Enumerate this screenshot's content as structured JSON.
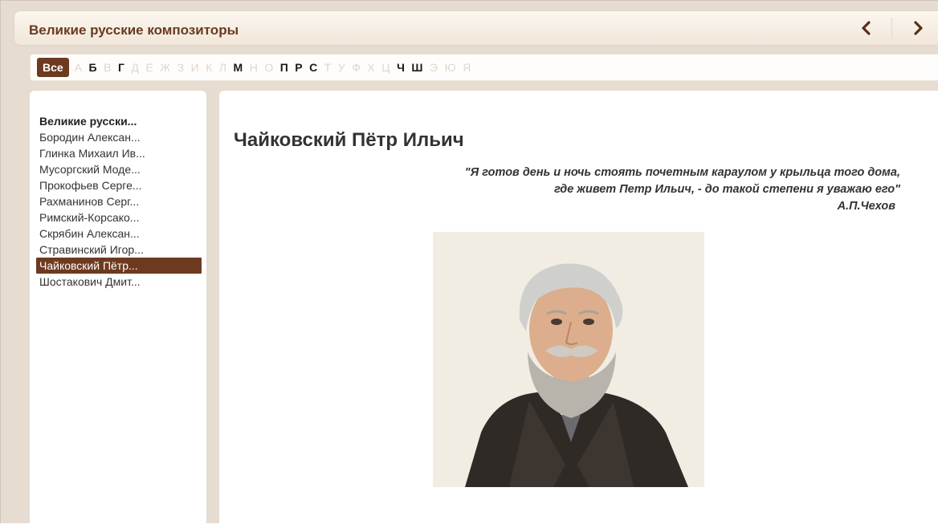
{
  "header": {
    "title": "Великие русские композиторы",
    "prev_icon": "chevron-left-icon",
    "next_icon": "chevron-right-icon"
  },
  "alphabet": {
    "all_label": "Все",
    "letters": [
      {
        "char": "А",
        "active": false
      },
      {
        "char": "Б",
        "active": true
      },
      {
        "char": "В",
        "active": false
      },
      {
        "char": "Г",
        "active": true
      },
      {
        "char": "Д",
        "active": false
      },
      {
        "char": "Е",
        "active": false
      },
      {
        "char": "Ж",
        "active": false
      },
      {
        "char": "З",
        "active": false
      },
      {
        "char": "И",
        "active": false
      },
      {
        "char": "К",
        "active": false
      },
      {
        "char": "Л",
        "active": false
      },
      {
        "char": "М",
        "active": true
      },
      {
        "char": "Н",
        "active": false
      },
      {
        "char": "О",
        "active": false
      },
      {
        "char": "П",
        "active": true
      },
      {
        "char": "Р",
        "active": true
      },
      {
        "char": "С",
        "active": true
      },
      {
        "char": "Т",
        "active": false
      },
      {
        "char": "У",
        "active": false
      },
      {
        "char": "Ф",
        "active": false
      },
      {
        "char": "Х",
        "active": false
      },
      {
        "char": "Ц",
        "active": false
      },
      {
        "char": "Ч",
        "active": true
      },
      {
        "char": "Ш",
        "active": true
      },
      {
        "char": "Э",
        "active": false
      },
      {
        "char": "Ю",
        "active": false
      },
      {
        "char": "Я",
        "active": false
      }
    ]
  },
  "sidebar": {
    "items": [
      {
        "label": "Великие русски...",
        "type": "heading"
      },
      {
        "label": "Бородин Алексан...",
        "type": "item"
      },
      {
        "label": "Глинка Михаил Ив...",
        "type": "item"
      },
      {
        "label": "Мусоргский Моде...",
        "type": "item"
      },
      {
        "label": "Прокофьев Серге...",
        "type": "item"
      },
      {
        "label": "Рахманинов Серг...",
        "type": "item"
      },
      {
        "label": "Римский-Корсако...",
        "type": "item"
      },
      {
        "label": "Скрябин Алексан...",
        "type": "item"
      },
      {
        "label": "Стравинский Игор...",
        "type": "item"
      },
      {
        "label": "Чайковский Пётр...",
        "type": "selected"
      },
      {
        "label": "Шостакович Дмит...",
        "type": "item"
      }
    ]
  },
  "main": {
    "composer_name": "Чайковский Пётр Ильич",
    "quote_line1": "\"Я готов день и ночь стоять почетным караулом у крыльца того дома,",
    "quote_line2": "где живет Петр Ильич, - до такой степени я уважаю его\"",
    "quote_author": "А.П.Чехов"
  },
  "colors": {
    "accent": "#6e3a1f",
    "title_text": "#6b3a20",
    "frame_bg": "#e6dcd1",
    "inactive_letter": "#e2d5cb"
  }
}
